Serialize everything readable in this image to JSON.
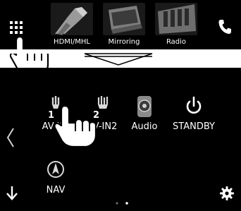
{
  "top_strip": {
    "sources": [
      {
        "id": "hdmi",
        "label": "HDMI/MHL"
      },
      {
        "id": "mirroring",
        "label": "Mirroring"
      },
      {
        "id": "radio",
        "label": "Radio"
      }
    ],
    "icons": {
      "menu": "grid-icon",
      "phone": "phone-icon",
      "hand": "tap-hand-icon"
    }
  },
  "transition": {
    "icon": "down-arrow-icon"
  },
  "home_screen": {
    "apps": [
      {
        "id": "av-in1",
        "label": "AV-IN1",
        "icon": "av-input-1-icon"
      },
      {
        "id": "av-in2",
        "label": "AV-IN2",
        "icon": "av-input-2-icon"
      },
      {
        "id": "audio",
        "label": "Audio",
        "icon": "speaker-icon"
      },
      {
        "id": "standby",
        "label": "STANDBY",
        "icon": "power-icon"
      },
      {
        "id": "nav",
        "label": "NAV",
        "icon": "navigation-icon"
      }
    ],
    "icons": {
      "prev": "chevron-left-icon",
      "back": "back-arrow-icon",
      "settings": "gear-icon",
      "hand": "tap-hand-icon"
    },
    "page_indicator": {
      "pages": 2,
      "current": 2
    }
  }
}
